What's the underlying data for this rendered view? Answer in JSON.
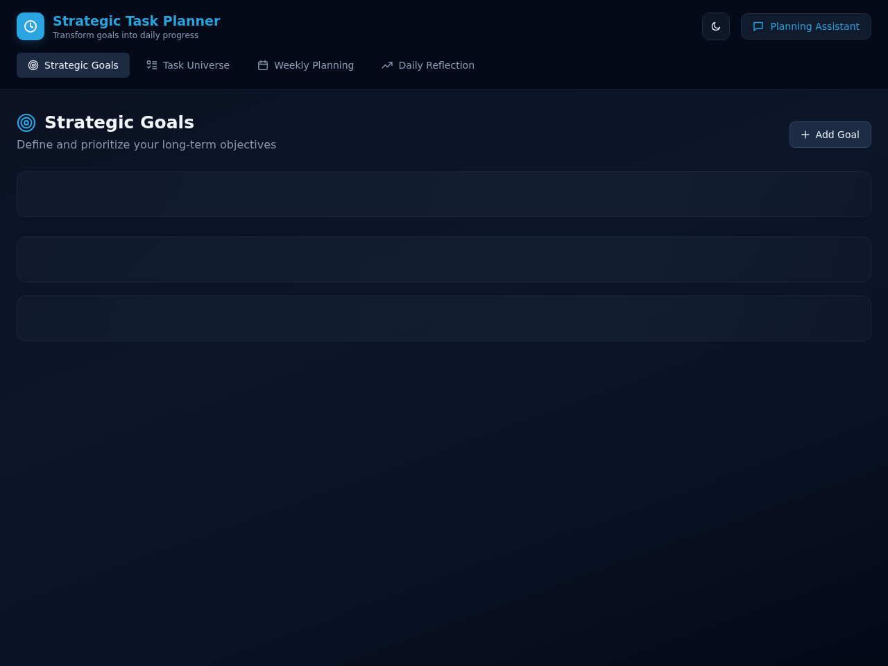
{
  "app": {
    "title": "Strategic Task Planner",
    "subtitle": "Transform goals into daily progress"
  },
  "header_actions": {
    "theme_toggle": {
      "kind": "dark"
    },
    "assistant_button": {
      "label": "Planning Assistant"
    }
  },
  "tabs": [
    {
      "label": "Strategic Goals",
      "selected": true
    },
    {
      "label": "Task Universe",
      "selected": false
    },
    {
      "label": "Weekly Planning",
      "selected": false
    },
    {
      "label": "Daily Reflection",
      "selected": false
    }
  ],
  "section": {
    "title": "Strategic Goals",
    "subtitle": "Define and prioritize your long-term objectives",
    "add_button": {
      "label": "Add Goal"
    }
  },
  "goals": [
    {
      "kind": "loading"
    },
    {
      "kind": "loading"
    },
    {
      "kind": "loading"
    }
  ]
}
